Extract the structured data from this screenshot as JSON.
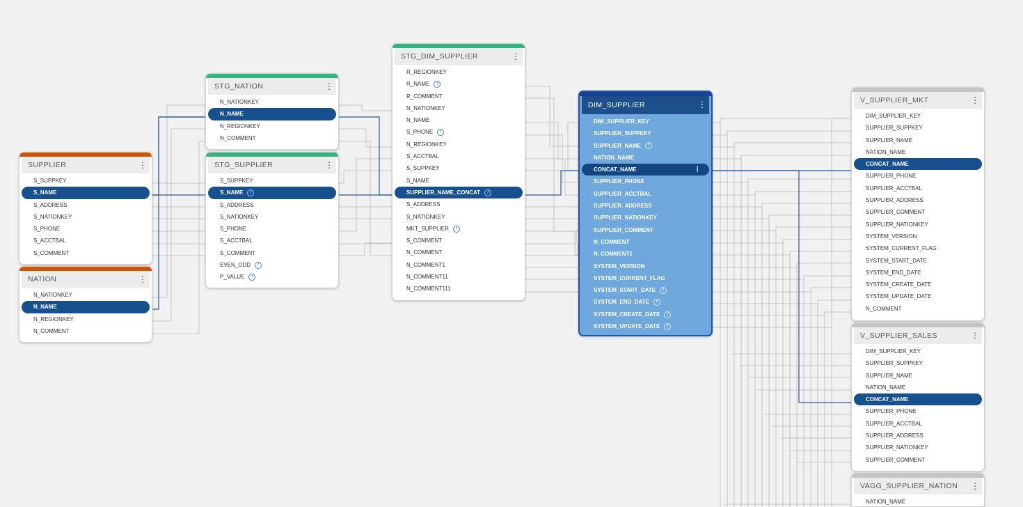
{
  "colors": {
    "source": "#d35400",
    "staging": "#2eb67d",
    "dim": "#1c3f91",
    "view": "#c4c4c4",
    "highlight": "#16508f",
    "link": "#1f5aa8",
    "line": "#b8b8b8"
  },
  "icons": {
    "menu": "⋮",
    "info": "f"
  },
  "nodes": {
    "supplier": {
      "title": "SUPPLIER",
      "rows": [
        "S_SUPPKEY",
        "S_NAME",
        "S_ADDRESS",
        "S_NATIONKEY",
        "S_PHONE",
        "S_ACCTBAL",
        "S_COMMENT"
      ]
    },
    "nation": {
      "title": "NATION",
      "rows": [
        "N_NATIONKEY",
        "N_NAME",
        "N_REGIONKEY",
        "N_COMMENT"
      ]
    },
    "stg_nation": {
      "title": "STG_NATION",
      "rows": [
        "N_NATIONKEY",
        "N_NAME",
        "N_REGIONKEY",
        "N_COMMENT"
      ]
    },
    "stg_supplier": {
      "title": "STG_SUPPLIER",
      "rows": [
        "S_SUPPKEY",
        "S_NAME",
        "S_ADDRESS",
        "S_NATIONKEY",
        "S_PHONE",
        "S_ACCTBAL",
        "S_COMMENT",
        "EVEN_ODD",
        "P_VALUE"
      ]
    },
    "stg_dim_supplier": {
      "title": "STG_DIM_SUPPLIER",
      "rows": [
        "R_REGIONKEY",
        "R_NAME",
        "R_COMMENT",
        "N_NATIONKEY",
        "N_NAME",
        "S_PHONE",
        "N_REGIONKEY",
        "S_ACCTBAL",
        "S_SUPPKEY",
        "S_NAME",
        "SUPPLIER_NAME_CONCAT",
        "S_ADDRESS",
        "S_NATIONKEY",
        "MKT_SUPPLIER",
        "S_COMMENT",
        "N_COMMENT",
        "N_COMMENT1",
        "N_COMMENT11",
        "N_COMMENT111"
      ]
    },
    "dim_supplier": {
      "title": "DIM_SUPPLIER",
      "rows": [
        "DIM_SUPPLIER_KEY",
        "SUPPLIER_SUPPKEY",
        "SUPPLIER_NAME",
        "NATION_NAME",
        "CONCAT_NAME",
        "SUPPLIER_PHONE",
        "SUPPLIER_ACCTBAL",
        "SUPPLIER_ADDRESS",
        "SUPPLIER_NATIONKEY",
        "SUPPLIER_COMMENT",
        "N_COMMENT",
        "N_COMMENT1",
        "SYSTEM_VERSION",
        "SYSTEM_CURRENT_FLAG",
        "SYSTEM_START_DATE",
        "SYSTEM_END_DATE",
        "SYSTEM_CREATE_DATE",
        "SYSTEM_UPDATE_DATE"
      ]
    },
    "v_supplier_mkt": {
      "title": "V_SUPPLIER_MKT",
      "rows": [
        "DIM_SUPPLIER_KEY",
        "SUPPLIER_SUPPKEY",
        "SUPPLIER_NAME",
        "NATION_NAME",
        "CONCAT_NAME",
        "SUPPLIER_PHONE",
        "SUPPLIER_ACCTBAL",
        "SUPPLIER_ADDRESS",
        "SUPPLIER_COMMENT",
        "SUPPLIER_NATIONKEY",
        "SYSTEM_VERSION",
        "SYSTEM_CURRENT_FLAG",
        "SYSTEM_START_DATE",
        "SYSTEM_END_DATE",
        "SYSTEM_CREATE_DATE",
        "SYSTEM_UPDATE_DATE",
        "N_COMMENT"
      ]
    },
    "v_supplier_sales": {
      "title": "V_SUPPLIER_SALES",
      "rows": [
        "DIM_SUPPLIER_KEY",
        "SUPPLIER_SUPPKEY",
        "SUPPLIER_NAME",
        "NATION_NAME",
        "CONCAT_NAME",
        "SUPPLIER_PHONE",
        "SUPPLIER_ACCTBAL",
        "SUPPLIER_ADDRESS",
        "SUPPLIER_NATIONKEY",
        "SUPPLIER_COMMENT"
      ]
    },
    "vagg_supplier_nation": {
      "title": "VAGG_SUPPLIER_NATION",
      "rows": [
        "NATION_NAME"
      ]
    }
  }
}
